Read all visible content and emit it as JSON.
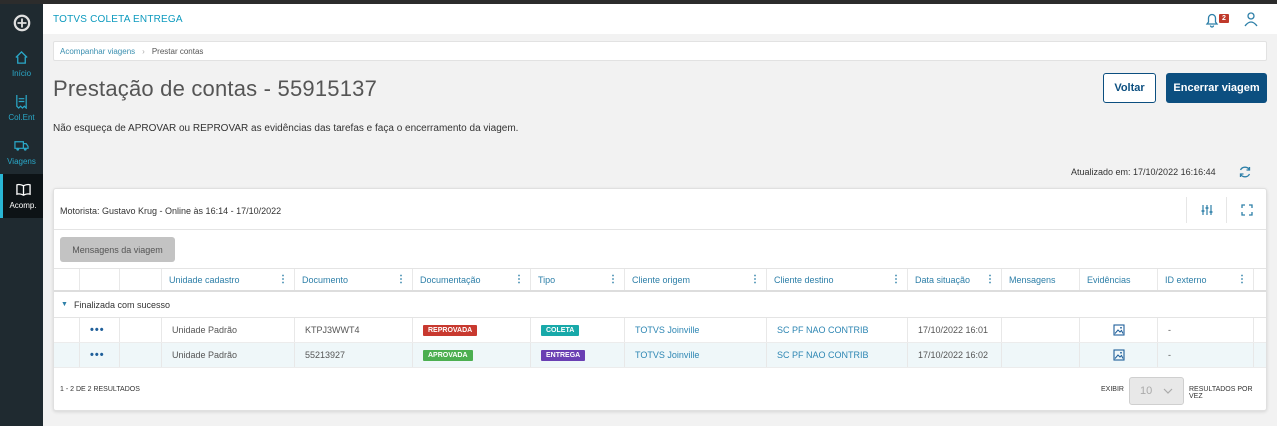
{
  "app": {
    "title": "TOTVS COLETA ENTREGA",
    "notification_count": "2"
  },
  "sidebar": {
    "items": [
      {
        "label": "Início",
        "icon": "home-icon"
      },
      {
        "label": "Col.Ent",
        "icon": "receipt-icon"
      },
      {
        "label": "Viagens",
        "icon": "truck-icon"
      },
      {
        "label": "Acomp.",
        "icon": "book-icon",
        "active": true
      }
    ]
  },
  "breadcrumb": {
    "items": [
      "Acompanhar viagens",
      "Prestar contas"
    ]
  },
  "page": {
    "title": "Prestação de contas - 55915137",
    "back_label": "Voltar",
    "finish_label": "Encerrar viagem",
    "notice": "Não esqueça de APROVAR ou REPROVAR as evidências das tarefas e faça o encerramento da viagem.",
    "updated": "Atualizado em: 17/10/2022 16:16:44"
  },
  "card": {
    "driver": "Motorista: Gustavo Krug - Online às 16:14 - 17/10/2022",
    "messages_button": "Mensagens da viagem"
  },
  "table": {
    "columns": [
      "Unidade cadastro",
      "Documento",
      "Documentação",
      "Tipo",
      "Cliente origem",
      "Cliente destino",
      "Data situação",
      "Mensagens",
      "Evidências",
      "ID externo"
    ],
    "group": "Finalizada com sucesso",
    "rows": [
      {
        "unidade": "Unidade Padrão",
        "documento": "KTPJ3WWT4",
        "documentacao": "REPROVADA",
        "tipo": "COLETA",
        "origem": "TOTVS Joinville",
        "destino": "SC PF NAO CONTRIB",
        "data": "17/10/2022 16:01",
        "id_externo": "-"
      },
      {
        "unidade": "Unidade Padrão",
        "documento": "55213927",
        "documentacao": "APROVADA",
        "tipo": "ENTREGA",
        "origem": "TOTVS Joinville",
        "destino": "SC PF NAO CONTRIB",
        "data": "17/10/2022 16:02",
        "id_externo": "-"
      }
    ]
  },
  "footer": {
    "count": "1 - 2 DE 2 RESULTADOS",
    "show_label": "EXIBIR",
    "page_size": "10",
    "per_page_label": "RESULTADOS POR VEZ"
  },
  "colors": {
    "primary": "#0c4f80",
    "accent": "#0c9abe",
    "reprovada": "#c8392f",
    "aprovada": "#4caf50",
    "coleta": "#18a9a9",
    "entrega": "#6a3fb3"
  }
}
